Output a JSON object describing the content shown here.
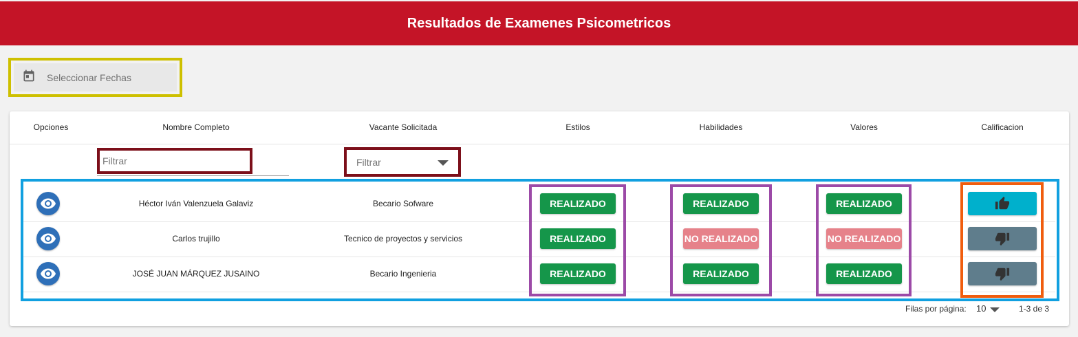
{
  "header": {
    "title": "Resultados de Examenes Psicometricos"
  },
  "date_picker": {
    "label": "Seleccionar Fechas",
    "icon": "calendar-icon"
  },
  "table": {
    "columns": [
      "Opciones",
      "Nombre Completo",
      "Vacante Solicitada",
      "Estilos",
      "Habilidades",
      "Valores",
      "Calificacion"
    ],
    "filters": {
      "name_placeholder": "Filtrar",
      "vacancy_placeholder": "Filtrar"
    },
    "rows": [
      {
        "name": "Héctor Iván Valenzuela Galaviz",
        "vacancy": "Becario Sofware",
        "estilos": "REALIZADO",
        "habilidades": "REALIZADO",
        "valores": "REALIZADO",
        "calificacion": "thumbs-up"
      },
      {
        "name": "Carlos trujillo",
        "vacancy": "Tecnico de proyectos y servicios",
        "estilos": "REALIZADO",
        "habilidades": "NO REALIZADO",
        "valores": "NO REALIZADO",
        "calificacion": "thumbs-down"
      },
      {
        "name": "JOSÉ JUAN MÁRQUEZ JUSAINO",
        "vacancy": "Becario Ingenieria",
        "estilos": "REALIZADO",
        "habilidades": "REALIZADO",
        "valores": "REALIZADO",
        "calificacion": "thumbs-down"
      }
    ]
  },
  "pagination": {
    "rows_per_page_label": "Filas por página:",
    "rows_per_page": "10",
    "range": "1-3 de 3"
  },
  "colors": {
    "header": "#c41427",
    "done": "#15964a",
    "not_done": "#e6828a",
    "thumb_up": "#00b0cc",
    "thumb_down": "#5f7d8c"
  }
}
